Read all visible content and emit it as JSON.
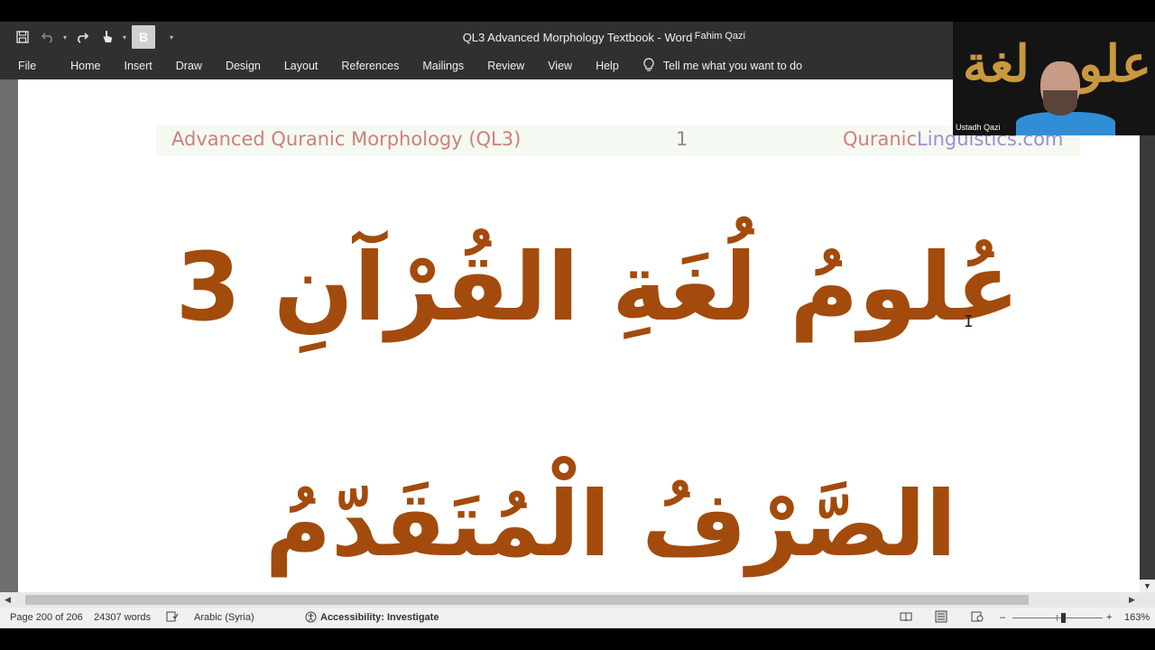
{
  "window": {
    "title": "QL3 Advanced Morphology Textbook  -  Word",
    "user": "Fahim Qazi"
  },
  "qat": {
    "save_icon": "save-icon",
    "undo_icon": "undo-icon",
    "redo_icon": "redo-icon",
    "touch_icon": "touch-mode-icon",
    "bold_label": "B",
    "customize_icon": "customize-qat-icon"
  },
  "ribbon": {
    "tabs": [
      "File",
      "Home",
      "Insert",
      "Draw",
      "Design",
      "Layout",
      "References",
      "Mailings",
      "Review",
      "View",
      "Help"
    ],
    "tellme": "Tell me what you want to do"
  },
  "document": {
    "header_left": "Advanced Quranic Morphology (QL3)",
    "header_page": "1",
    "header_right_a": "Quranic",
    "header_right_b": "Linguistics.com",
    "title_line1": "عُلومُ لُغَةِ القُرْآنِ 3",
    "title_line2": "الصَّرْفُ الْمُتَقَدّمُ"
  },
  "statusbar": {
    "page": "Page 200 of 206",
    "words": "24307 words",
    "language": "Arabic (Syria)",
    "accessibility": "Accessibility: Investigate",
    "zoom_minus": "–",
    "zoom_plus": "+",
    "zoom_level": "163%"
  },
  "webcam": {
    "label": "Ustadh Qazi",
    "calligraphy": "علوم لغة القرآن"
  },
  "colors": {
    "title_bar": "#303030",
    "arabic_text": "#a24b0c",
    "header_red": "#d07f79",
    "header_purple": "#9f8cd0"
  }
}
